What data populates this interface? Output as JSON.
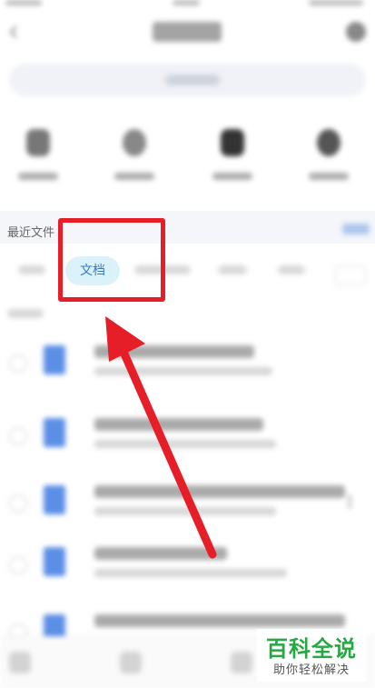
{
  "recent": {
    "label": "最近文件"
  },
  "tabs": {
    "active_label": "文档"
  },
  "watermark": {
    "title": "百科全说",
    "subtitle": "助你轻松解决"
  },
  "colors": {
    "accent": "#2b7bd6",
    "tab_active_bg": "#dcf2fb",
    "annotation": "#e61e28",
    "watermark_green": "#28a745",
    "file_icon": "#5b8fe6"
  },
  "icons": [
    "back-icon",
    "settings-icon",
    "doc-file-icon",
    "arrow-pointer"
  ]
}
